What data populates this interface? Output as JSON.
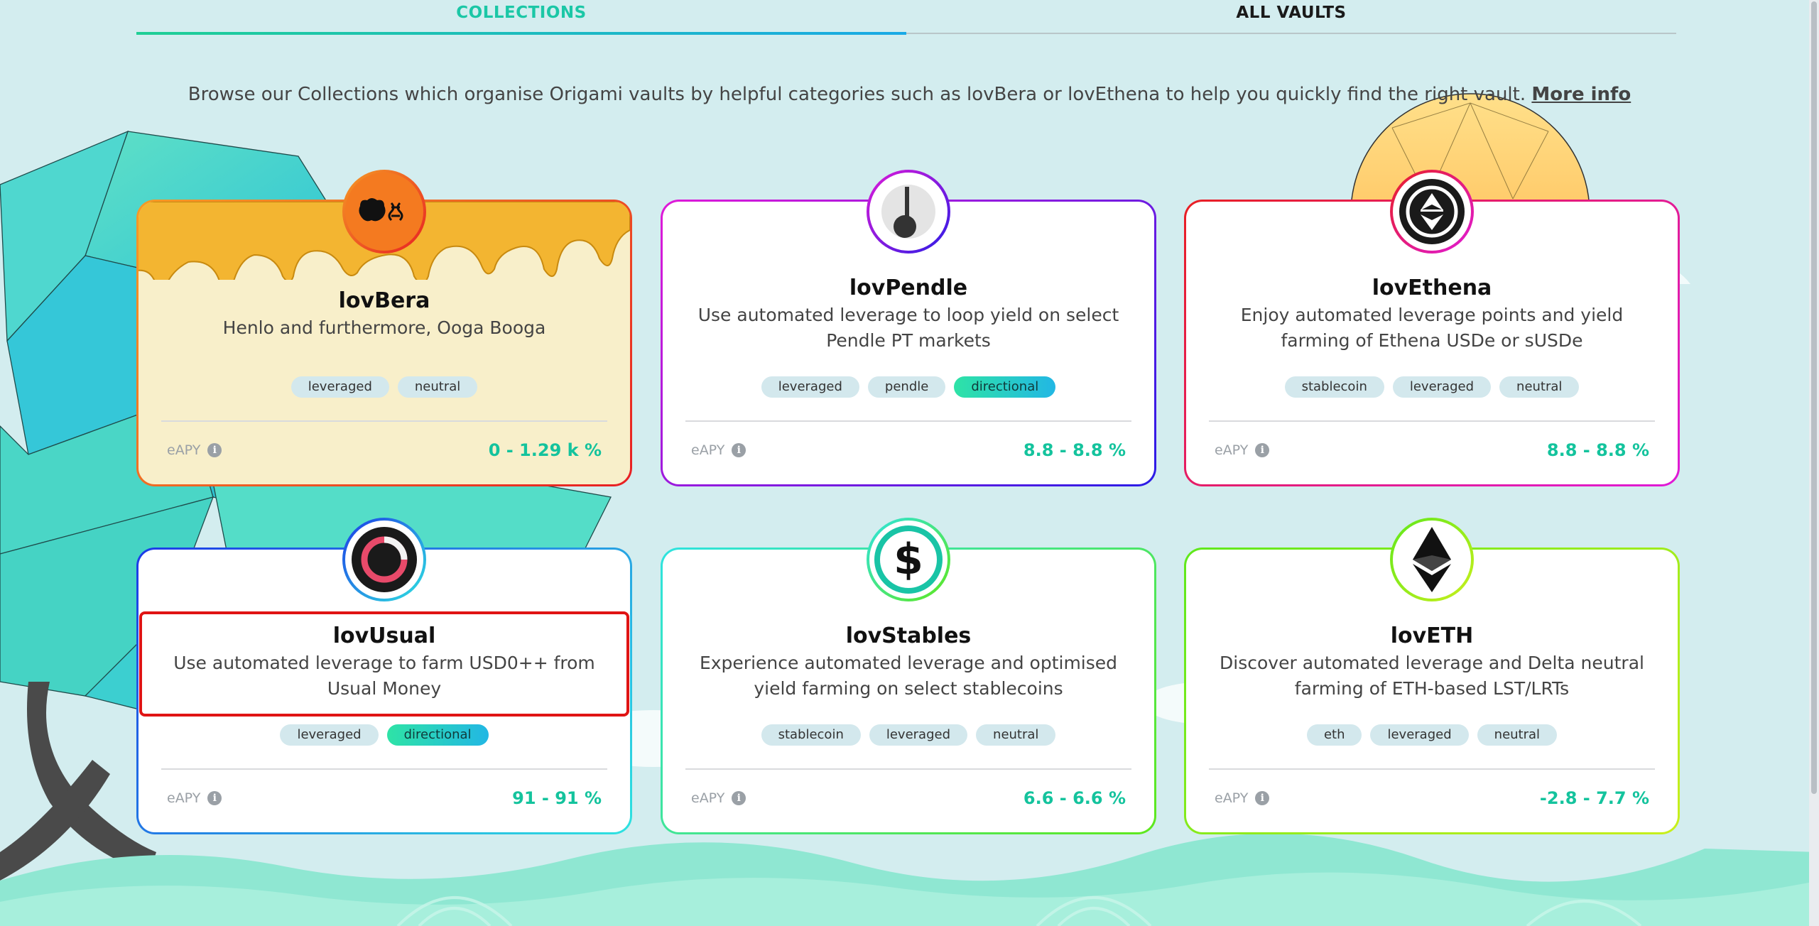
{
  "tabs": [
    {
      "label": "COLLECTIONS"
    },
    {
      "label": "ALL VAULTS"
    }
  ],
  "intro": {
    "text": "Browse our Collections which organise Origami vaults by helpful categories such as lovBera or lovEthena to help you quickly find the right vault.",
    "link": "More info"
  },
  "cards": [
    {
      "title": "lovBera",
      "desc": "Henlo and furthermore, Ooga Booga",
      "tags": [
        "leveraged",
        "neutral"
      ],
      "eapy_label": "eAPY",
      "apy": "0 - 1.29 k %"
    },
    {
      "title": "lovPendle",
      "desc": "Use automated leverage to loop yield on select Pendle PT markets",
      "tags": [
        "leveraged",
        "pendle",
        "directional"
      ],
      "eapy_label": "eAPY",
      "apy": "8.8 - 8.8 %"
    },
    {
      "title": "lovEthena",
      "desc": "Enjoy automated leverage points and yield farming of Ethena USDe or sUSDe",
      "tags": [
        "stablecoin",
        "leveraged",
        "neutral"
      ],
      "eapy_label": "eAPY",
      "apy": "8.8 - 8.8 %"
    },
    {
      "title": "lovUsual",
      "desc": "Use automated leverage to farm USD0++ from Usual Money",
      "tags": [
        "leveraged",
        "directional"
      ],
      "eapy_label": "eAPY",
      "apy": "91 - 91 %"
    },
    {
      "title": "lovStables",
      "desc": "Experience automated leverage and optimised yield farming on select stablecoins",
      "tags": [
        "stablecoin",
        "leveraged",
        "neutral"
      ],
      "eapy_label": "eAPY",
      "apy": "6.6 - 6.6 %"
    },
    {
      "title": "lovETH",
      "desc": "Discover automated leverage and Delta neutral farming of ETH-based LST/LRTs",
      "tags": [
        "eth",
        "leveraged",
        "neutral"
      ],
      "eapy_label": "eAPY",
      "apy": "-2.8 - 7.7 %"
    }
  ],
  "icons": {
    "info": "i",
    "usd": "$"
  },
  "colors": {
    "accent_green": "#14c39d",
    "highlight_red": "#e01414"
  }
}
